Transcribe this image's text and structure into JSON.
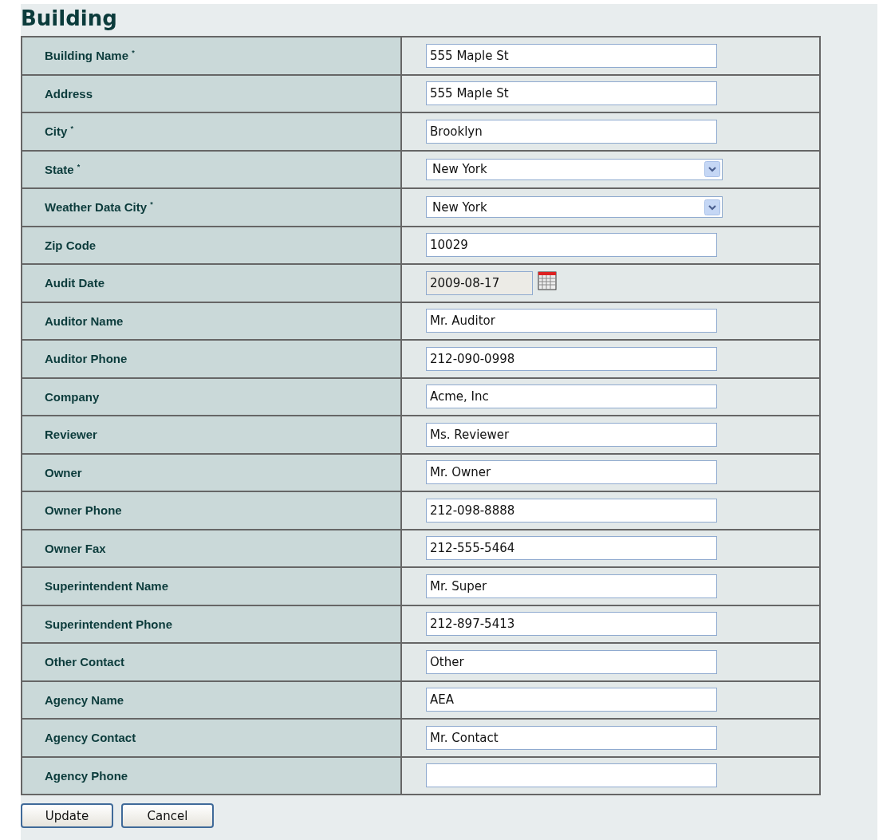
{
  "title": "Building",
  "fields": [
    {
      "label": "Building Name $^{*}$",
      "kind": "text",
      "value": "555 Maple St"
    },
    {
      "label": "Address",
      "kind": "text",
      "value": "555 Maple St"
    },
    {
      "label": "City $^{*}$",
      "kind": "text",
      "value": "Brooklyn"
    },
    {
      "label": "State $^{*}$",
      "kind": "select",
      "value": "New York"
    },
    {
      "label": "Weather Data City $^{*}$",
      "kind": "select",
      "value": "New York"
    },
    {
      "label": "Zip Code",
      "kind": "text",
      "value": "10029"
    },
    {
      "label": "Audit Date",
      "kind": "date",
      "value": "2009-08-17"
    },
    {
      "label": "Auditor Name",
      "kind": "text",
      "value": "Mr. Auditor"
    },
    {
      "label": "Auditor Phone",
      "kind": "text",
      "value": "212-090-0998"
    },
    {
      "label": "Company",
      "kind": "text",
      "value": "Acme, Inc"
    },
    {
      "label": "Reviewer",
      "kind": "text",
      "value": "Ms. Reviewer"
    },
    {
      "label": "Owner",
      "kind": "text",
      "value": "Mr. Owner"
    },
    {
      "label": "Owner Phone",
      "kind": "text",
      "value": "212-098-8888"
    },
    {
      "label": "Owner Fax",
      "kind": "text",
      "value": "212-555-5464"
    },
    {
      "label": "Superintendent Name",
      "kind": "text",
      "value": "Mr. Super"
    },
    {
      "label": "Superintendent Phone",
      "kind": "text",
      "value": "212-897-5413"
    },
    {
      "label": "Other Contact",
      "kind": "text",
      "value": "Other"
    },
    {
      "label": "Agency Name",
      "kind": "text",
      "value": "AEA"
    },
    {
      "label": "Agency Contact",
      "kind": "text",
      "value": "Mr. Contact"
    },
    {
      "label": "Agency Phone",
      "kind": "text"
    }
  ],
  "buttons": [
    "Update",
    "Cancel"
  ]
}
